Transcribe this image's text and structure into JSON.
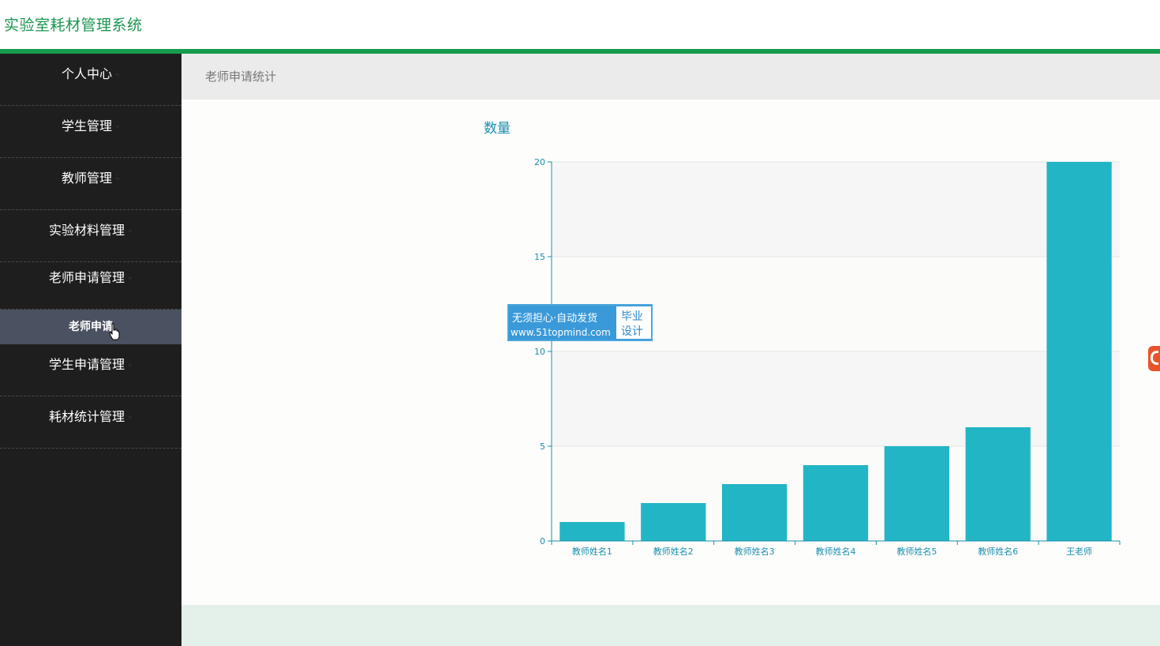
{
  "app": {
    "title": "实验室耗材管理系统"
  },
  "sidebar": {
    "items": [
      {
        "label": "个人中心"
      },
      {
        "label": "学生管理"
      },
      {
        "label": "教师管理"
      },
      {
        "label": "实验材料管理"
      },
      {
        "label": "老师申请管理"
      },
      {
        "label": "学生申请管理"
      },
      {
        "label": "耗材统计管理"
      }
    ],
    "active_sub": {
      "label": "老师申请"
    }
  },
  "breadcrumb": "老师申请统计",
  "chart_data": {
    "type": "bar",
    "title": "数量",
    "categories": [
      "教师姓名1",
      "教师姓名2",
      "教师姓名3",
      "教师姓名4",
      "教师姓名5",
      "教师姓名6",
      "王老师"
    ],
    "values": [
      1,
      2,
      3,
      4,
      5,
      6,
      20
    ],
    "ylim": [
      0,
      20
    ],
    "yticks": [
      0,
      5,
      10,
      15,
      20
    ],
    "grid": true,
    "bar_color": "#22b5c6",
    "axis_color": "#1a8fb0"
  },
  "ad_overlay": {
    "line1": "无须担心·自动发货",
    "line2": "www.51topmind.com",
    "right1": "毕业",
    "right2": "设计"
  },
  "colors": {
    "brand_green": "#169c4e",
    "sidebar_bg": "#1e1e1e",
    "active_sub_bg": "#4a5160"
  }
}
